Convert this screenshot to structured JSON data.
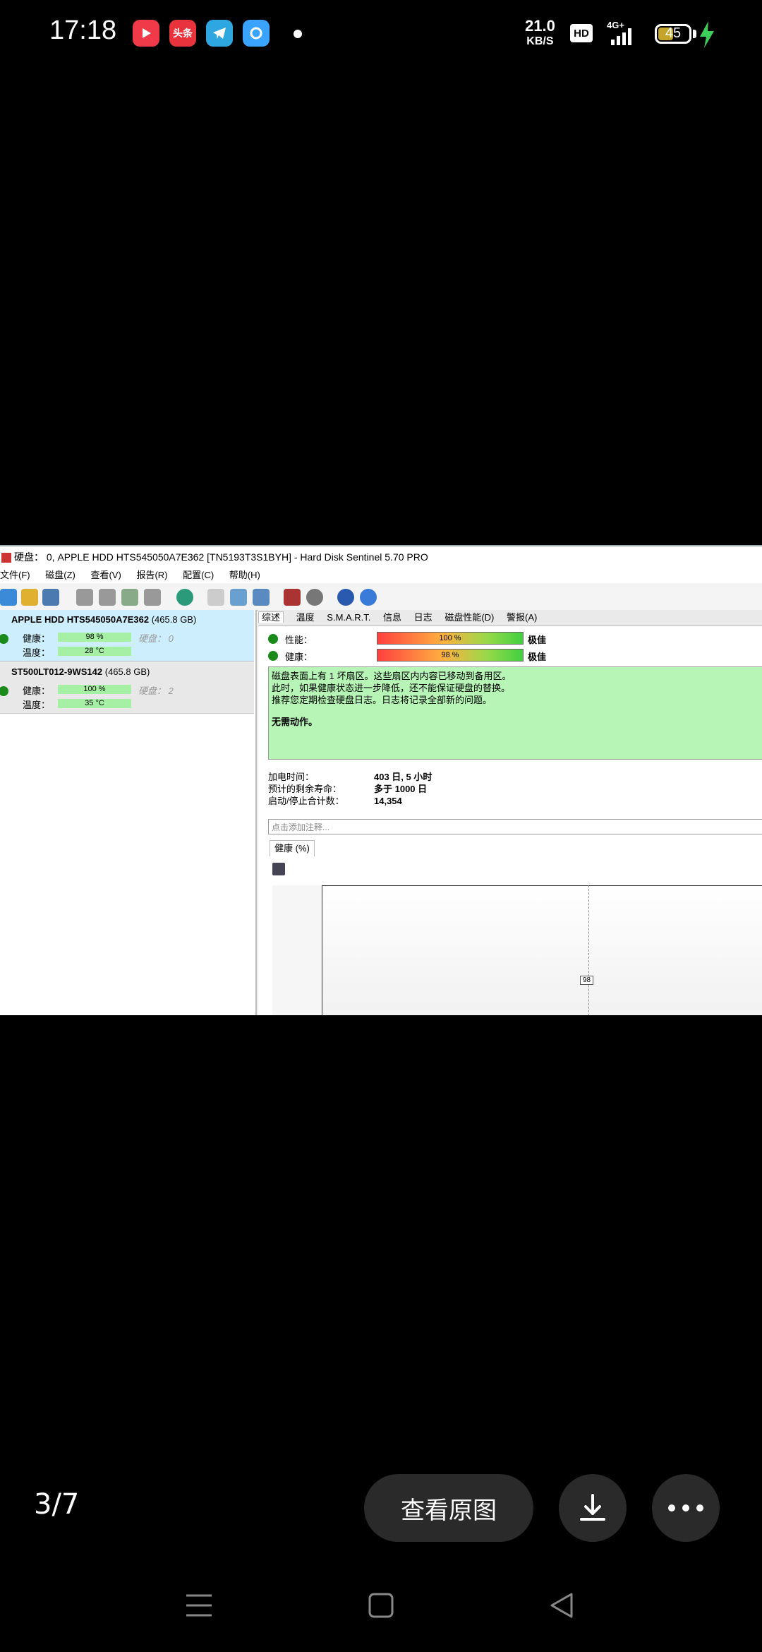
{
  "status_bar": {
    "time": "17:18",
    "apps": [
      {
        "name": "video-app",
        "label": "",
        "color": "#f03a4a"
      },
      {
        "name": "toutiao-app",
        "label": "头条",
        "color": "#e8323c"
      },
      {
        "name": "telegram-app",
        "label": "",
        "color": "#2ea6e0"
      },
      {
        "name": "browser-app",
        "label": "",
        "color": "#3aa2ff"
      }
    ],
    "net_speed": "21.0",
    "net_unit": "KB/S",
    "hd": "HD",
    "network": "4G+",
    "battery": "45"
  },
  "window": {
    "title": "硬盘： 0, APPLE HDD HTS545050A7E362 [TN5193T3S1BYH]  -  Hard Disk Sentinel 5.70 PRO",
    "menu": [
      "文件(F)",
      "磁盘(Z)",
      "查看(V)",
      "报告(R)",
      "配置(C)",
      "帮助(H)"
    ]
  },
  "disks": [
    {
      "name": "APPLE HDD HTS545050A7E362",
      "size": "(465.8 GB)",
      "health_label": "健康：",
      "health": "98 %",
      "temp_label": "温度：",
      "temp": "28 °C",
      "disk_label": "硬盘： 0"
    },
    {
      "name": "ST500LT012-9WS142",
      "size": "(465.8 GB)",
      "health_label": "健康：",
      "health": "100 %",
      "temp_label": "温度：",
      "temp": "35 °C",
      "disk_label": "硬盘： 2"
    }
  ],
  "tabs": [
    "综述",
    "温度",
    "S.M.A.R.T.",
    "信息",
    "日志",
    "磁盘性能(D)",
    "警报(A)"
  ],
  "overview": {
    "perf_label": "性能：",
    "perf_value": "100 %",
    "perf_fill": 100,
    "perf_grade": "极佳",
    "health_label": "健康：",
    "health_value": "98 %",
    "health_fill": 98,
    "health_grade": "极佳",
    "message_lines": [
      "磁盘表面上有 1 坏扇区。这些扇区内内容已移动到备用区。",
      "此时，如果健康状态进一步降低，还不能保证硬盘的替换。",
      "推荐您定期检查硬盘日志。日志将记录全部新的问题。"
    ],
    "action": "无需动作。",
    "power_on_label": "加电时间：",
    "power_on": "403 日, 5 小时",
    "lifetime_label": "预计的剩余寿命：",
    "lifetime": "多于 1000 日",
    "start_stop_label": "启动/停止合计数：",
    "start_stop": "14,354",
    "note_placeholder": "点击添加注释...",
    "chart_tab": "健康 (%)",
    "chart_point": "98"
  },
  "viewer": {
    "pager": "3/7",
    "view_original": "查看原图"
  }
}
